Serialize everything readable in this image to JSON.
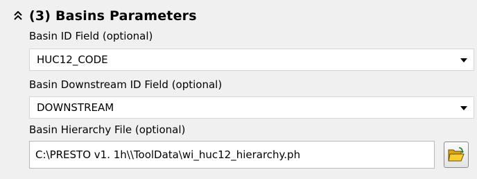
{
  "section": {
    "title": "(3) Basins Parameters",
    "collapse_icon": "double-chevron-up-icon"
  },
  "fields": {
    "basin_id": {
      "label": "Basin ID Field (optional)",
      "value": "HUC12_CODE"
    },
    "basin_downstream_id": {
      "label": "Basin Downstream ID Field (optional)",
      "value": "DOWNSTREAM"
    },
    "basin_hierarchy_file": {
      "label": "Basin Hierarchy File (optional)",
      "value": "C:\\PRESTO v1. 1h\\\\ToolData\\wi_huc12_hierarchy.ph",
      "browse_icon": "open-folder-icon"
    }
  },
  "colors": {
    "panel_bg": "#f0f0f0",
    "field_bg": "#ffffff",
    "folder_yellow": "#f2c21a"
  }
}
